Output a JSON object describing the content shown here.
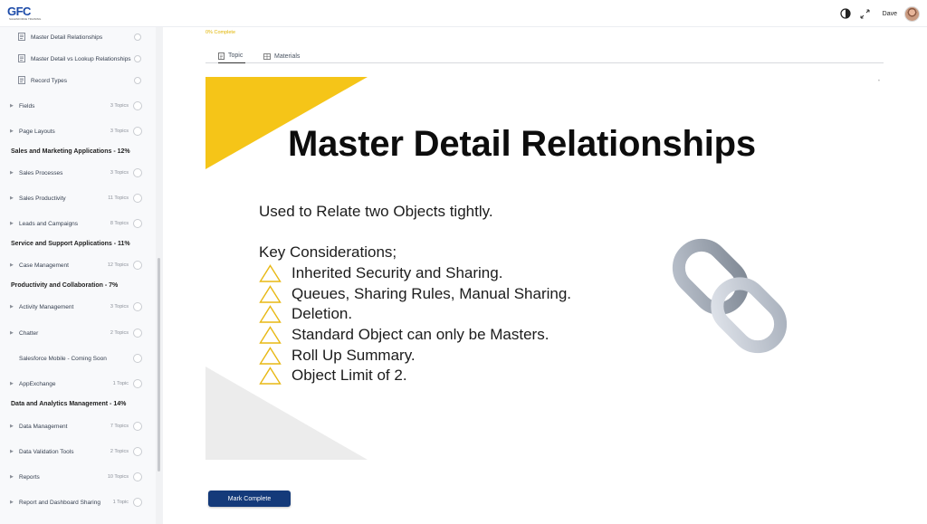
{
  "app": {
    "logo_text": "GFC",
    "logo_subtitle": "SALESFORCE TRAINING"
  },
  "header": {
    "user_name": "Dave"
  },
  "sidebar": {
    "rows": [
      {
        "type": "lesson",
        "label": "Master Detail Relationships",
        "count": "",
        "top": 0
      },
      {
        "type": "lesson",
        "label": "Master Detail vs Lookup Relationships",
        "count": ""
      },
      {
        "type": "lesson",
        "label": "Record Types",
        "count": ""
      },
      {
        "type": "module",
        "label": "Fields",
        "count": "3 Topics"
      },
      {
        "type": "module",
        "label": "Page Layouts",
        "count": "3 Topics"
      },
      {
        "type": "section",
        "label": "Sales and Marketing Applications - 12%"
      },
      {
        "type": "module",
        "label": "Sales Processes",
        "count": "3 Topics"
      },
      {
        "type": "module",
        "label": "Sales Productivity",
        "count": "11 Topics"
      },
      {
        "type": "module",
        "label": "Leads and Campaigns",
        "count": "8 Topics"
      },
      {
        "type": "section",
        "label": "Service and Support Applications - 11%"
      },
      {
        "type": "module",
        "label": "Case Management",
        "count": "12 Topics"
      },
      {
        "type": "section",
        "label": "Productivity and Collaboration - 7%"
      },
      {
        "type": "module",
        "label": "Activity Management",
        "count": "3 Topics"
      },
      {
        "type": "module",
        "label": "Chatter",
        "count": "2 Topics"
      },
      {
        "type": "plain",
        "label": "Salesforce Mobile - Coming Soon",
        "count": ""
      },
      {
        "type": "module",
        "label": "AppExchange",
        "count": "1 Topic"
      },
      {
        "type": "section",
        "label": "Data and Analytics Management - 14%"
      },
      {
        "type": "module",
        "label": "Data Management",
        "count": "7 Topics"
      },
      {
        "type": "module",
        "label": "Data Validation Tools",
        "count": "2 Topics"
      },
      {
        "type": "module",
        "label": "Reports",
        "count": "10 Topics"
      },
      {
        "type": "module",
        "label": "Report and Dashboard Sharing",
        "count": "1 Topic"
      }
    ]
  },
  "main": {
    "progress_text": "0% Complete",
    "tabs": [
      {
        "label": "Topic",
        "active": true
      },
      {
        "label": "Materials",
        "active": false
      }
    ],
    "slide": {
      "title": "Master Detail Relationships",
      "lead": "Used to Relate two Objects tightly.",
      "key_heading": "Key Considerations;",
      "bullets": [
        "Inherited Security and Sharing.",
        "Queues, Sharing Rules, Manual Sharing.",
        "Deletion.",
        "Standard Object can only be Masters.",
        "Roll Up Summary.",
        "Object Limit of 2."
      ],
      "accent_color": "#f5c518",
      "chain_icon": "chain-link-icon"
    },
    "mark_complete_label": "Mark Complete"
  }
}
